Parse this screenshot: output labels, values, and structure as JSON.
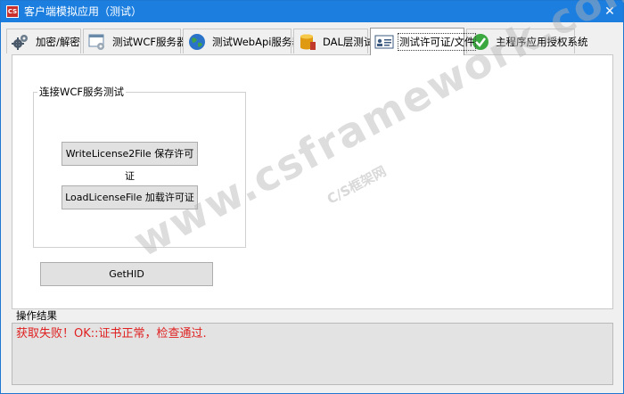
{
  "window": {
    "title": "客户端模拟应用（测试）",
    "app_badge": "CS",
    "close_glyph": "✕",
    "accent_color": "#1c7fe0"
  },
  "tabs": [
    {
      "label": "加密/解密",
      "icon": "gears-icon",
      "active": false
    },
    {
      "label": "测试WCF服务器",
      "icon": "server-window-icon",
      "active": false
    },
    {
      "label": "测试WebApi服务器",
      "icon": "globe-icon",
      "active": false
    },
    {
      "label": "DAL层测试",
      "icon": "database-icon",
      "active": false
    },
    {
      "label": "测试许可证/文件",
      "icon": "id-card-icon",
      "active": true
    },
    {
      "label": "主程序应用授权系统",
      "icon": "check-circle-icon",
      "active": false
    }
  ],
  "panel": {
    "group_title": "连接WCF服务测试",
    "write_license_button": "WriteLicense2File 保存许可证",
    "load_license_button": "LoadLicenseFile 加载许可证",
    "gethid_button": "GetHID"
  },
  "result": {
    "label": "操作结果",
    "text": "获取失败！OK::证书正常，检查通过.",
    "text_color": "#e02020"
  },
  "watermark": {
    "main": "www.csframework.com",
    "sub": "C/S框架网"
  }
}
